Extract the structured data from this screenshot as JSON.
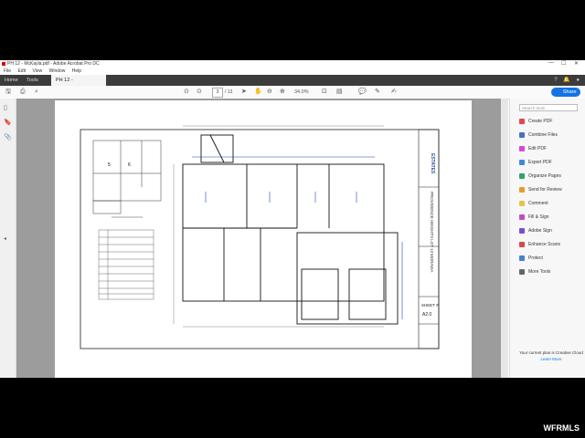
{
  "window": {
    "title": "PH 12 - McKayla.pdf - Adobe Acrobat Pro DC",
    "controls": [
      "—",
      "☐",
      "✕"
    ]
  },
  "menu": [
    "File",
    "Edit",
    "View",
    "Window",
    "Help"
  ],
  "tabs": {
    "home": "Home",
    "tools": "Tools",
    "document": "PH 12 - McKayla.pdf"
  },
  "toolbar": {
    "page_current": "3",
    "page_total": "/ 13",
    "zoom": "34.0%",
    "share_label": "Share"
  },
  "sidebar_right": {
    "search_placeholder": "Search tools",
    "tools": [
      {
        "label": "Create PDF",
        "color": "#e34850"
      },
      {
        "label": "Combine Files",
        "color": "#4b6ec8"
      },
      {
        "label": "Edit PDF",
        "color": "#d24bd2"
      },
      {
        "label": "Export PDF",
        "color": "#3c8bd7"
      },
      {
        "label": "Organize Pages",
        "color": "#2fa36b"
      },
      {
        "label": "Send for Review",
        "color": "#e69b2e"
      },
      {
        "label": "Comment",
        "color": "#e8c34b"
      },
      {
        "label": "Fill & Sign",
        "color": "#c44bc4"
      },
      {
        "label": "Adobe Sign",
        "color": "#7d4bd2"
      },
      {
        "label": "Enhance Scans",
        "color": "#d24b4b"
      },
      {
        "label": "Protect",
        "color": "#4b7dd2"
      },
      {
        "label": "More Tools",
        "color": "#666666"
      }
    ],
    "plan_text": "Your current plan is Creative Cloud",
    "learn_more": "Learn More"
  },
  "drawing": {
    "title_block": "PROVIDENCE HEIGHTS LOT 12",
    "sheet_label": "SHEET #",
    "sheet_number": "A2.0",
    "brand": "MORAVIA"
  },
  "watermark": "WFRMLS"
}
